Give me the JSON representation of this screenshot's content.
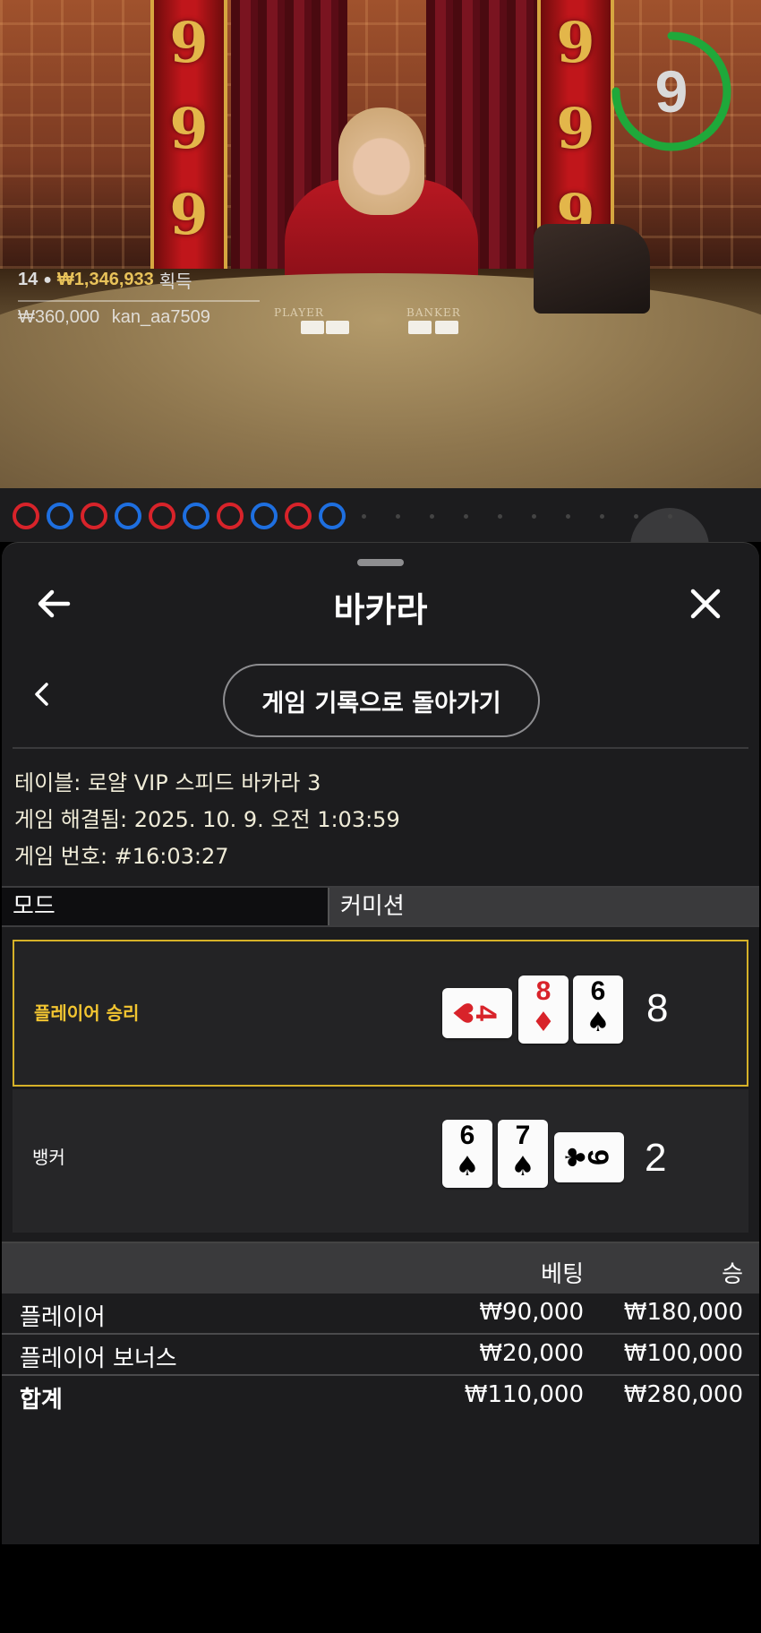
{
  "live": {
    "timer_value": "9",
    "timer_progress": 0.75,
    "player_count": "14",
    "total_win": "₩1,346,933",
    "total_win_suffix": "획득",
    "last_win_amount": "₩360,000",
    "last_win_user": "kan_aa7509",
    "felt_player_label": "PLAYER",
    "felt_banker_label": "BANKER",
    "pillar_digit": "9"
  },
  "road": {
    "results": [
      "red",
      "blue",
      "red",
      "blue",
      "red",
      "blue",
      "red",
      "blue",
      "red",
      "blue"
    ]
  },
  "header": {
    "title": "바카라"
  },
  "nav": {
    "back_to_history_label": "게임 기록으로 돌아가기"
  },
  "info": {
    "table": "테이블: 로얄 VIP 스피드 바카라 3",
    "resolved": "게임 해결됨: 2025. 10. 9. 오전 1:03:59",
    "game_number": "게임 번호: #16:03:27"
  },
  "mode_bar": {
    "mode_label": "모드",
    "commission_label": "커미션"
  },
  "hands": {
    "player": {
      "label": "플레이어 승리",
      "score": "8",
      "cards": [
        {
          "rank": "4",
          "suit": "♥",
          "color": "red",
          "orientation": "sideways"
        },
        {
          "rank": "8",
          "suit": "♦",
          "color": "red",
          "orientation": "upright"
        },
        {
          "rank": "6",
          "suit": "♠",
          "color": "black",
          "orientation": "upright"
        }
      ]
    },
    "banker": {
      "label": "뱅커",
      "score": "2",
      "cards": [
        {
          "rank": "6",
          "suit": "♠",
          "color": "black",
          "orientation": "upright"
        },
        {
          "rank": "7",
          "suit": "♠",
          "color": "black",
          "orientation": "upright"
        },
        {
          "rank": "9",
          "suit": "♣",
          "color": "black",
          "orientation": "sideways"
        }
      ]
    }
  },
  "bets_table": {
    "headers": {
      "bet": "베팅",
      "win": "승"
    },
    "rows": [
      {
        "label": "플레이어",
        "bet": "₩90,000",
        "win": "₩180,000"
      },
      {
        "label": "플레이어 보너스",
        "bet": "₩20,000",
        "win": "₩100,000"
      }
    ],
    "total": {
      "label": "합계",
      "bet": "₩110,000",
      "win": "₩280,000"
    }
  },
  "colors": {
    "highlight": "#d6b128",
    "win_label": "#f2c531",
    "timer_ring": "#1fa83a",
    "road_red": "#d8232a",
    "road_blue": "#1e6fe0"
  }
}
